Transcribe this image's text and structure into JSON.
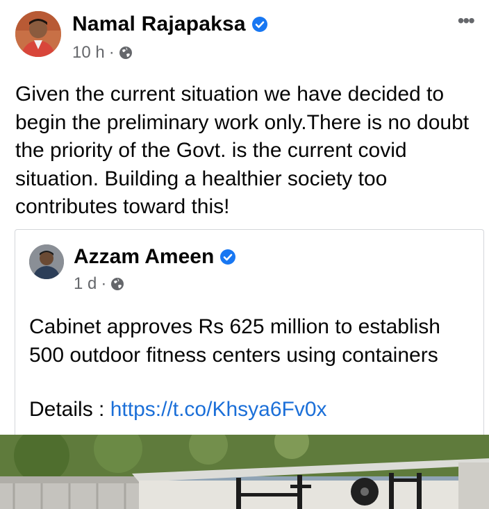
{
  "post": {
    "author": "Namal Rajapaksa",
    "time": "10 h",
    "separator": "·",
    "text": "Given the current situation we have decided to begin the preliminary work only.There is no doubt the priority of the Govt. is the current covid situation. Building a healthier society too contributes toward this!",
    "more_label": "•••"
  },
  "shared": {
    "author": "Azzam Ameen",
    "time": "1 d",
    "separator": "·",
    "text": "Cabinet approves Rs 625 million to establish 500 outdoor fitness centers using containers",
    "details_label": "Details : ",
    "link": "https://t.co/Khsya6Fv0x"
  },
  "icons": {
    "verified": "verified-badge-icon",
    "privacy": "globe-icon",
    "more": "more-options-icon"
  },
  "colors": {
    "verified": "#1877f2",
    "link": "#1b6fd8",
    "meta": "#65676b"
  }
}
